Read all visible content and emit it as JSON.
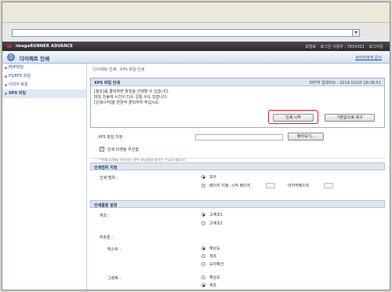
{
  "browser": {
    "dropdown_icon": "chevron-down-icon",
    "address_value": ""
  },
  "app": {
    "brand": "imageRUNNER ADVANCE",
    "top_links": [
      "포털로",
      "로그인 사용자 : 7654321",
      "로그아웃"
    ],
    "title": "다이렉트 인쇄",
    "admin_link": "관리자에게 문의"
  },
  "sidebar": {
    "items": [
      {
        "label": "PDF파일"
      },
      {
        "label": "PS/EPS 파일"
      },
      {
        "label": "이미지 파일"
      },
      {
        "label": "XPS 파일"
      }
    ]
  },
  "breadcrumb": "다이렉트 인쇄 : XPS 파일 인쇄",
  "panel": {
    "title": "XPS 파일 인쇄",
    "updated": "마지막 업데이트 : 2014 02/20 18:38:51",
    "notice_lines": [
      "[참조]를 클릭하면 파일을 선택할 수 있습니다.",
      "파일 전송에 시간이 다소 걸릴 수도 있습니다.",
      "[인쇄시작]을 한번씩 클릭하여 주십시오."
    ],
    "print_button": "인쇄 시작",
    "default_button": "기본값으로 복구"
  },
  "file_row": {
    "label": "XPS 파일 지정 :",
    "browse_button": "찾아보기...",
    "checkbox_label": "인쇄 티켓을 우선함",
    "checkbox_checked": true,
    "hint": "*인쇄 티켓을 우선하는 경우 해당설정 항목은 무효가 됩니다."
  },
  "range": {
    "section_title": "인쇄범위 지정",
    "label": "인쇄 범위 :",
    "option_all": "모두",
    "option_pages": "페이지 지정: 시작 페이지",
    "end_page": "마지막페이지"
  },
  "print_settings": {
    "section_title": "인쇄품질 설정",
    "tone_label": "계조 :",
    "tone_options": [
      "고계조1",
      "고계조2"
    ],
    "halftone_label": "하프톤 :",
    "text_label": "텍스트 :",
    "text_options": [
      "해상도",
      "계조",
      "오차확산"
    ],
    "graphic_label": "그래픽 :",
    "graphic_options": [
      "해상도",
      "계조"
    ]
  }
}
